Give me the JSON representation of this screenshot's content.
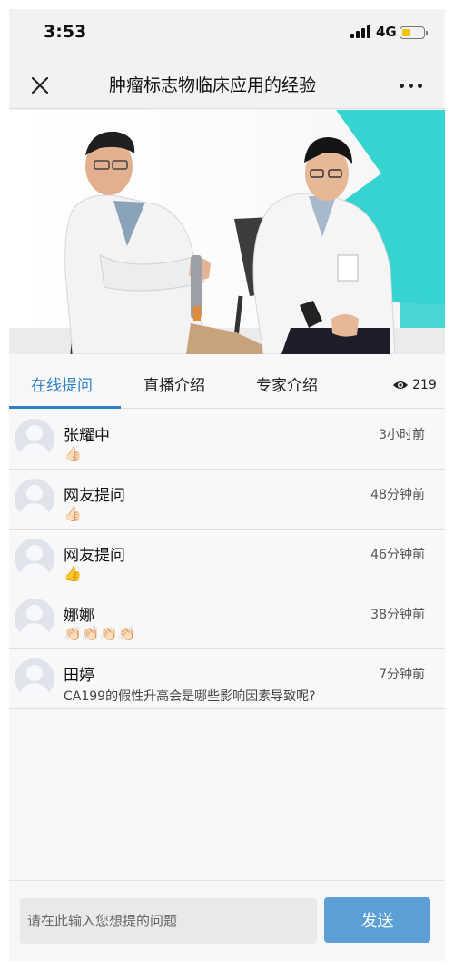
{
  "status_bar": {
    "time": "3:53",
    "network": "4G"
  },
  "nav": {
    "title": "肿瘤标志物临床应用的经验"
  },
  "tabs": [
    {
      "label": "在线提问",
      "active": true
    },
    {
      "label": "直播介绍",
      "active": false
    },
    {
      "label": "专家介绍",
      "active": false
    }
  ],
  "viewer_count": "219",
  "comments": [
    {
      "name": "张耀中",
      "time": "3小时前",
      "message": "👍🏻"
    },
    {
      "name": "网友提问",
      "time": "48分钟前",
      "message": "👍🏻"
    },
    {
      "name": "网友提问",
      "time": "46分钟前",
      "message": "👍"
    },
    {
      "name": "娜娜",
      "time": "38分钟前",
      "message": "👏🏻👏🏻👏🏻👏🏻"
    },
    {
      "name": "田婷",
      "time": "7分钟前",
      "message": "CA199的假性升高会是哪些影响因素导致呢?"
    }
  ],
  "input": {
    "placeholder": "请在此输入您想提的问题",
    "send_label": "发送"
  },
  "colors": {
    "accent": "#2f80c8",
    "send_button": "#5b9fd6",
    "teal_backdrop": "#37d3d1"
  }
}
